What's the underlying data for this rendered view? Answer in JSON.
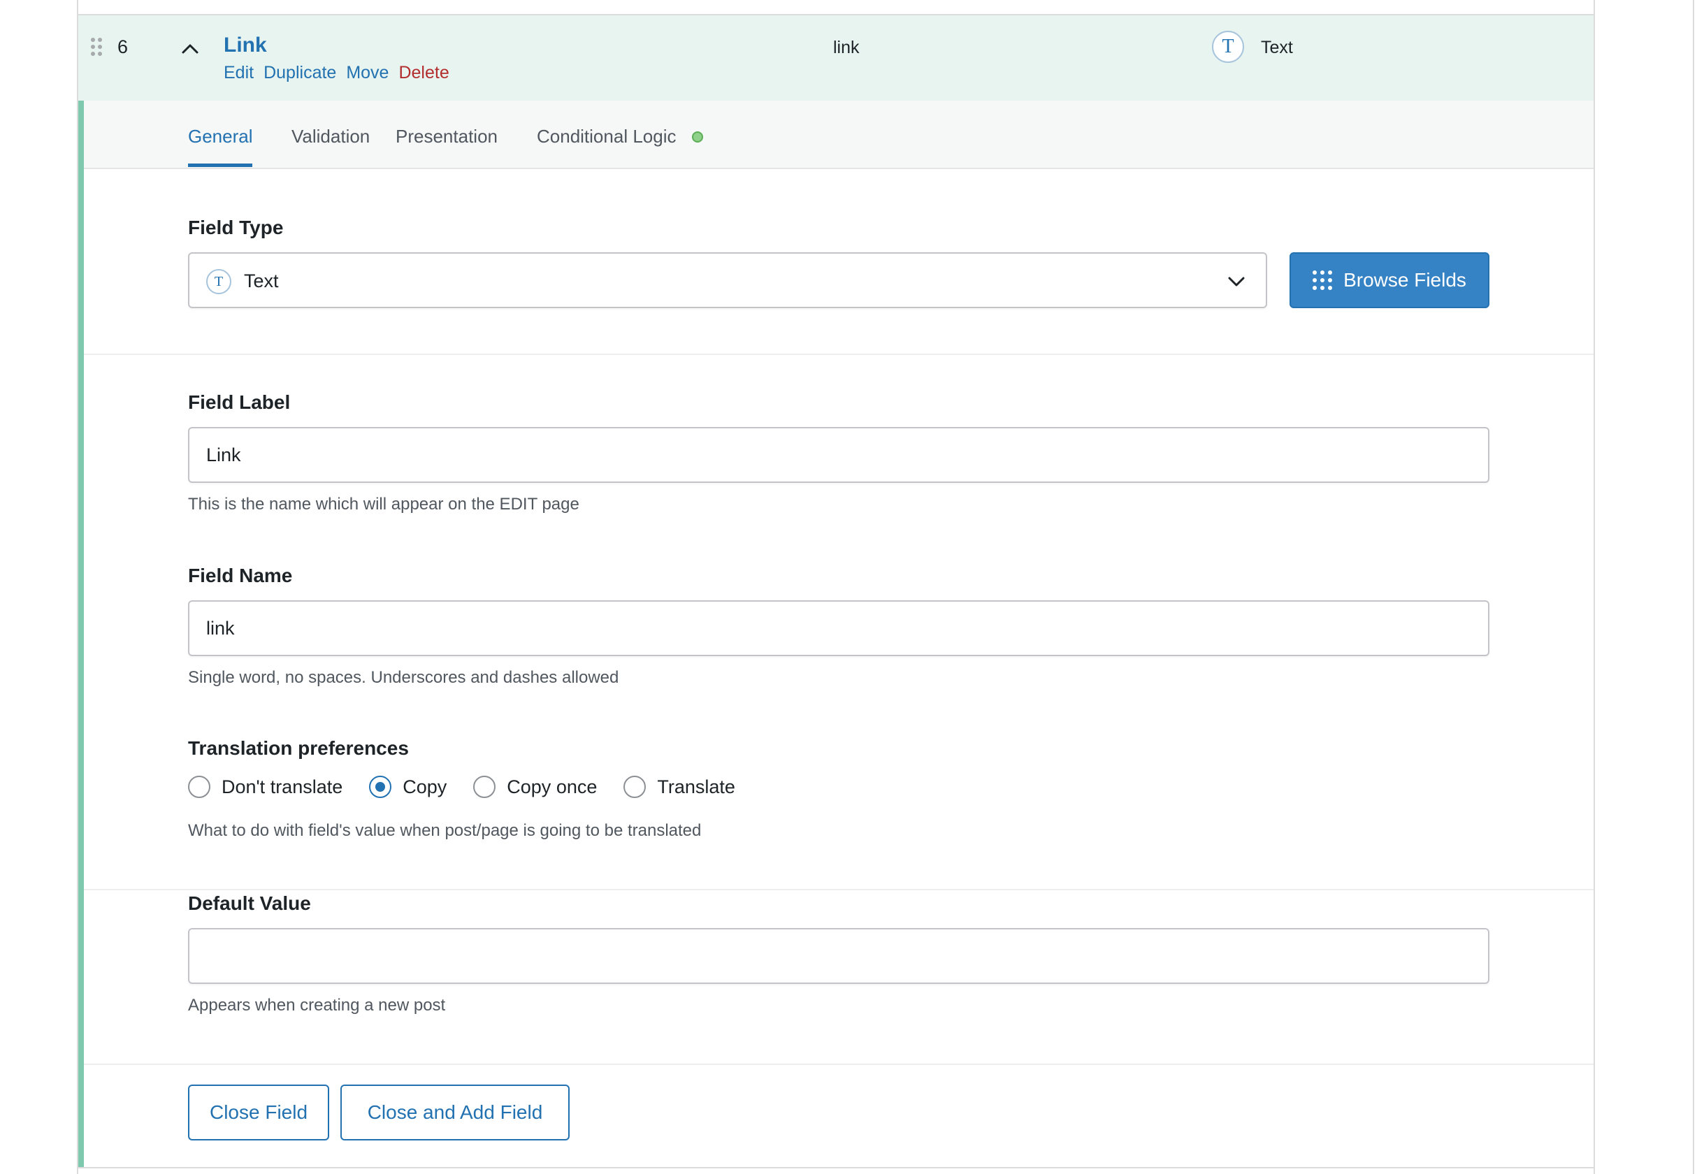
{
  "field_row": {
    "order": "6",
    "label": "Link",
    "actions": {
      "edit": "Edit",
      "duplicate": "Duplicate",
      "move": "Move",
      "delete": "Delete"
    },
    "name": "link",
    "type_icon": "T",
    "type_label": "Text"
  },
  "tabs": {
    "general": "General",
    "validation": "Validation",
    "presentation": "Presentation",
    "conditional_logic": "Conditional Logic"
  },
  "field_type": {
    "title": "Field Type",
    "icon": "T",
    "value": "Text",
    "browse_label": "Browse Fields"
  },
  "field_label": {
    "title": "Field Label",
    "value": "Link",
    "help": "This is the name which will appear on the EDIT page"
  },
  "field_name": {
    "title": "Field Name",
    "value": "link",
    "help": "Single word, no spaces. Underscores and dashes allowed"
  },
  "translation": {
    "title": "Translation preferences",
    "options": {
      "dont_translate": "Don't translate",
      "copy": "Copy",
      "copy_once": "Copy once",
      "translate": "Translate"
    },
    "selected": "Copy",
    "help": "What to do with field's value when post/page is going to be translated"
  },
  "default_value": {
    "title": "Default Value",
    "value": "",
    "help": "Appears when creating a new post"
  },
  "buttons": {
    "close_field": "Close Field",
    "close_and_add": "Close and Add Field"
  },
  "colors": {
    "accent": "#2271b1",
    "row_highlight": "#e8f4f0",
    "settings_border": "#7fc9ae",
    "delete": "#b32d2e"
  }
}
